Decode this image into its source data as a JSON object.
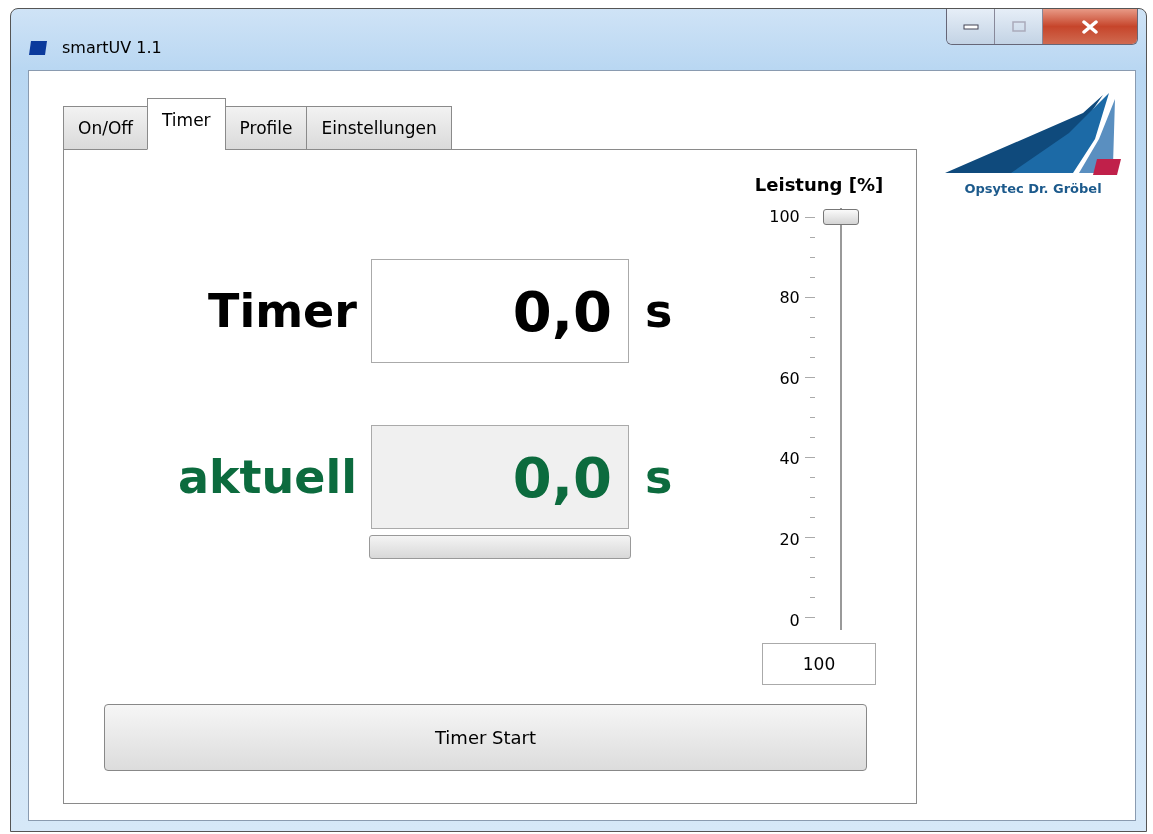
{
  "window": {
    "title": "smartUV 1.1"
  },
  "tabs": [
    {
      "label": "On/Off",
      "selected": false
    },
    {
      "label": "Timer",
      "selected": true
    },
    {
      "label": "Profile",
      "selected": false
    },
    {
      "label": "Einstellungen",
      "selected": false
    }
  ],
  "timer": {
    "label": "Timer",
    "value": "0,0",
    "unit": "s"
  },
  "current": {
    "label": "aktuell",
    "value": "0,0",
    "unit": "s",
    "progress": {
      "level": 0
    }
  },
  "power": {
    "title": "Leistung [%]",
    "ticks": [
      "100",
      "80",
      "60",
      "40",
      "20",
      "0"
    ],
    "level": 1,
    "value": "100"
  },
  "logo": {
    "text": "Opsytec Dr. Gröbel"
  },
  "start_button": "Timer Start"
}
